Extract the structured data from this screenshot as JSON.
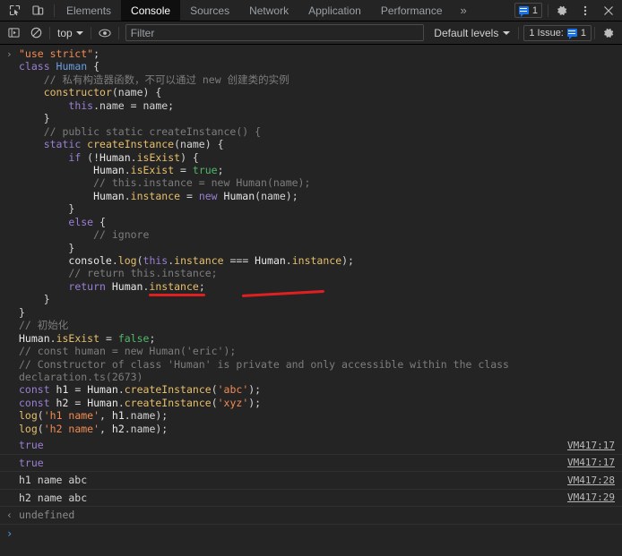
{
  "tabbar": {
    "icons": [
      {
        "name": "inspect-element-icon"
      },
      {
        "name": "device-toolbar-icon"
      }
    ],
    "tabs": [
      {
        "label": "Elements",
        "active": false
      },
      {
        "label": "Console",
        "active": true
      },
      {
        "label": "Sources",
        "active": false
      },
      {
        "label": "Network",
        "active": false
      },
      {
        "label": "Application",
        "active": false
      },
      {
        "label": "Performance",
        "active": false
      }
    ],
    "overflow_label": "»",
    "issues_count": "1",
    "settings_icon": "gear-icon",
    "more_icon": "dots-vertical-icon",
    "close_icon": "close-icon"
  },
  "consolebar": {
    "sidebar_toggle_icon": "console-sidebar-icon",
    "clear_icon": "clear-console-icon",
    "context": "top",
    "eye_icon": "live-expression-eye-icon",
    "filter_placeholder": "Filter",
    "filter_value": "",
    "levels_label": "Default levels",
    "issues_label": "1 Issue:",
    "issues_count": "1",
    "settings_icon": "console-settings-gear-icon"
  },
  "console": {
    "input_arrow": "›",
    "code_lines": [
      [
        {
          "t": "\"use strict\"",
          "c": "str"
        },
        {
          "t": ";",
          "c": "pl"
        }
      ],
      [
        {
          "t": "class ",
          "c": "k"
        },
        {
          "t": "Human",
          "c": "cls"
        },
        {
          "t": " {",
          "c": "pl"
        }
      ],
      [
        {
          "t": "    // 私有构造器函数，不可以通过 new 创建类的实例",
          "c": "cmt"
        }
      ],
      [
        {
          "t": "    ",
          "c": "pl"
        },
        {
          "t": "constructor",
          "c": "fn"
        },
        {
          "t": "(name) {",
          "c": "pl"
        }
      ],
      [
        {
          "t": "        ",
          "c": "pl"
        },
        {
          "t": "this",
          "c": "thi"
        },
        {
          "t": ".name = name;",
          "c": "pl"
        }
      ],
      [
        {
          "t": "    }",
          "c": "pl"
        }
      ],
      [
        {
          "t": "    // public static createInstance() {",
          "c": "cmt"
        }
      ],
      [
        {
          "t": "    ",
          "c": "pl"
        },
        {
          "t": "static ",
          "c": "k"
        },
        {
          "t": "createInstance",
          "c": "fn"
        },
        {
          "t": "(name) {",
          "c": "pl"
        }
      ],
      [
        {
          "t": "        ",
          "c": "pl"
        },
        {
          "t": "if",
          "c": "k"
        },
        {
          "t": " (!",
          "c": "pl"
        },
        {
          "t": "Human",
          "c": "wht"
        },
        {
          "t": ".",
          "c": "pl"
        },
        {
          "t": "isExist",
          "c": "prop"
        },
        {
          "t": ") {",
          "c": "pl"
        }
      ],
      [
        {
          "t": "            ",
          "c": "pl"
        },
        {
          "t": "Human",
          "c": "wht"
        },
        {
          "t": ".",
          "c": "pl"
        },
        {
          "t": "isExist",
          "c": "prop"
        },
        {
          "t": " = ",
          "c": "pl"
        },
        {
          "t": "true",
          "c": "bool"
        },
        {
          "t": ";",
          "c": "pl"
        }
      ],
      [
        {
          "t": "            // this.instance = new Human(name);",
          "c": "cmt"
        }
      ],
      [
        {
          "t": "            ",
          "c": "pl"
        },
        {
          "t": "Human",
          "c": "wht"
        },
        {
          "t": ".",
          "c": "pl"
        },
        {
          "t": "instance",
          "c": "prop"
        },
        {
          "t": " = ",
          "c": "pl"
        },
        {
          "t": "new ",
          "c": "k"
        },
        {
          "t": "Human",
          "c": "wht"
        },
        {
          "t": "(name);",
          "c": "pl"
        }
      ],
      [
        {
          "t": "        }",
          "c": "pl"
        }
      ],
      [
        {
          "t": "        ",
          "c": "pl"
        },
        {
          "t": "else",
          "c": "k"
        },
        {
          "t": " {",
          "c": "pl"
        }
      ],
      [
        {
          "t": "            // ignore",
          "c": "cmt"
        }
      ],
      [
        {
          "t": "        }",
          "c": "pl"
        }
      ],
      [
        {
          "t": "        ",
          "c": "pl"
        },
        {
          "t": "console",
          "c": "wht"
        },
        {
          "t": ".",
          "c": "pl"
        },
        {
          "t": "log",
          "c": "prop"
        },
        {
          "t": "(",
          "c": "pl"
        },
        {
          "t": "this",
          "c": "thi"
        },
        {
          "t": ".",
          "c": "pl"
        },
        {
          "t": "instance",
          "c": "prop"
        },
        {
          "t": " === ",
          "c": "pl"
        },
        {
          "t": "Human",
          "c": "wht"
        },
        {
          "t": ".",
          "c": "pl"
        },
        {
          "t": "instance",
          "c": "prop"
        },
        {
          "t": ");",
          "c": "pl"
        }
      ],
      [
        {
          "t": "        // return this.instance;",
          "c": "cmt"
        }
      ],
      [
        {
          "t": "        ",
          "c": "pl"
        },
        {
          "t": "return ",
          "c": "k"
        },
        {
          "t": "Human",
          "c": "wht"
        },
        {
          "t": ".",
          "c": "pl"
        },
        {
          "t": "instance",
          "c": "prop"
        },
        {
          "t": ";",
          "c": "pl"
        }
      ],
      [
        {
          "t": "    }",
          "c": "pl"
        }
      ],
      [
        {
          "t": "}",
          "c": "pl"
        }
      ],
      [
        {
          "t": "// 初始化",
          "c": "cmt"
        }
      ],
      [
        {
          "t": "Human",
          "c": "wht"
        },
        {
          "t": ".",
          "c": "pl"
        },
        {
          "t": "isExist",
          "c": "prop"
        },
        {
          "t": " = ",
          "c": "pl"
        },
        {
          "t": "false",
          "c": "bool"
        },
        {
          "t": ";",
          "c": "pl"
        }
      ],
      [
        {
          "t": "// const human = new Human('eric');",
          "c": "cmt"
        }
      ],
      [
        {
          "t": "// Constructor of class 'Human' is private and only accessible within the class",
          "c": "cmt"
        }
      ],
      [
        {
          "t": "declaration.ts(2673)",
          "c": "cmt"
        }
      ],
      [
        {
          "t": "const ",
          "c": "k"
        },
        {
          "t": "h1",
          "c": "wht"
        },
        {
          "t": " = ",
          "c": "pl"
        },
        {
          "t": "Human",
          "c": "wht"
        },
        {
          "t": ".",
          "c": "pl"
        },
        {
          "t": "createInstance",
          "c": "fn"
        },
        {
          "t": "(",
          "c": "pl"
        },
        {
          "t": "'abc'",
          "c": "str"
        },
        {
          "t": ");",
          "c": "pl"
        }
      ],
      [
        {
          "t": "const ",
          "c": "k"
        },
        {
          "t": "h2",
          "c": "wht"
        },
        {
          "t": " = ",
          "c": "pl"
        },
        {
          "t": "Human",
          "c": "wht"
        },
        {
          "t": ".",
          "c": "pl"
        },
        {
          "t": "createInstance",
          "c": "fn"
        },
        {
          "t": "(",
          "c": "pl"
        },
        {
          "t": "'xyz'",
          "c": "str"
        },
        {
          "t": ");",
          "c": "pl"
        }
      ],
      [
        {
          "t": "log",
          "c": "fn"
        },
        {
          "t": "(",
          "c": "pl"
        },
        {
          "t": "'h1 name'",
          "c": "str"
        },
        {
          "t": ", ",
          "c": "pl"
        },
        {
          "t": "h1",
          "c": "wht"
        },
        {
          "t": ".name);",
          "c": "pl"
        }
      ],
      [
        {
          "t": "log",
          "c": "fn"
        },
        {
          "t": "(",
          "c": "pl"
        },
        {
          "t": "'h2 name'",
          "c": "str"
        },
        {
          "t": ", ",
          "c": "pl"
        },
        {
          "t": "h2",
          "c": "wht"
        },
        {
          "t": ".name);",
          "c": "pl"
        }
      ]
    ],
    "output_rows": [
      {
        "value": "true",
        "kind": "boolean",
        "source": "VM417:17"
      },
      {
        "value": "true",
        "kind": "boolean",
        "source": "VM417:17"
      },
      {
        "value": "h1 name abc",
        "kind": "text",
        "source": "VM417:28"
      },
      {
        "value": "h2 name abc",
        "kind": "text",
        "source": "VM417:29"
      }
    ],
    "return_arrow": "‹",
    "return_value": "undefined",
    "prompt_arrow": "›"
  },
  "colors": {
    "background": "#242424",
    "active_tab_bg": "#0f0f0f",
    "accent_blue": "#1a73e8",
    "annotation_red": "#e02020",
    "string_orange": "#f28b54",
    "keyword_purple": "#9a7fd4",
    "property_yellow": "#e8bf6a",
    "comment_gray": "#7d7d7d",
    "boolean_green": "#51b86a"
  }
}
